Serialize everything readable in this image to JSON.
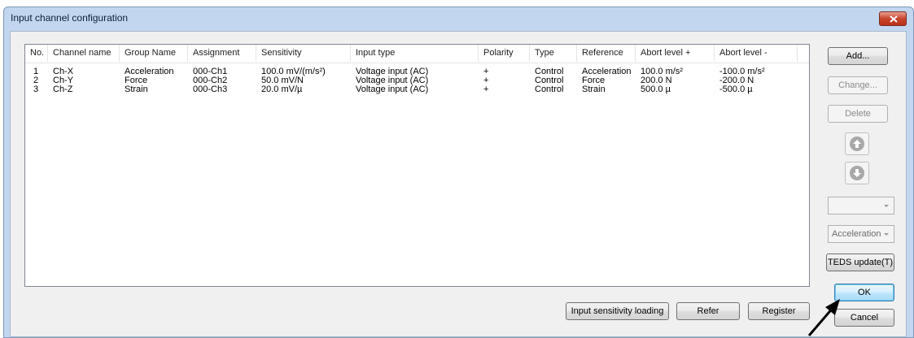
{
  "window": {
    "title": "Input channel configuration"
  },
  "columns": [
    "No.",
    "Channel name",
    "Group Name",
    "Assignment",
    "Sensitivity",
    "Input type",
    "Polarity",
    "Type",
    "Reference",
    "Abort level +",
    "Abort level -"
  ],
  "rows": [
    [
      "1",
      "Ch-X",
      "Acceleration",
      "000-Ch1",
      "100.0 mV/(m/s²)",
      "Voltage input (AC)",
      "+",
      "Control",
      "Acceleration",
      "100.0 m/s²",
      "-100.0 m/s²"
    ],
    [
      "2",
      "Ch-Y",
      "Force",
      "000-Ch2",
      "50.0 mV/N",
      "Voltage input (AC)",
      "+",
      "Control",
      "Force",
      "200.0 N",
      "-200.0 N"
    ],
    [
      "3",
      "Ch-Z",
      "Strain",
      "000-Ch3",
      "20.0 mV/µ",
      "Voltage input (AC)",
      "+",
      "Control",
      "Strain",
      "500.0 µ",
      "-500.0 µ"
    ]
  ],
  "side": {
    "add_label": "Add...",
    "change_label": "Change...",
    "delete_label": "Delete",
    "combo_empty_value": "",
    "combo_reference_value": "Acceleration",
    "teds_label": "TEDS update(T)",
    "ok_label": "OK",
    "cancel_label": "Cancel"
  },
  "bottom": {
    "input_sensitivity_label": "Input sensitivity loading",
    "refer_label": "Refer",
    "register_label": "Register"
  },
  "colors": {
    "close": "#c8442c",
    "title_bg": "#c2d7ef",
    "default_button": "#3c7fb1"
  }
}
